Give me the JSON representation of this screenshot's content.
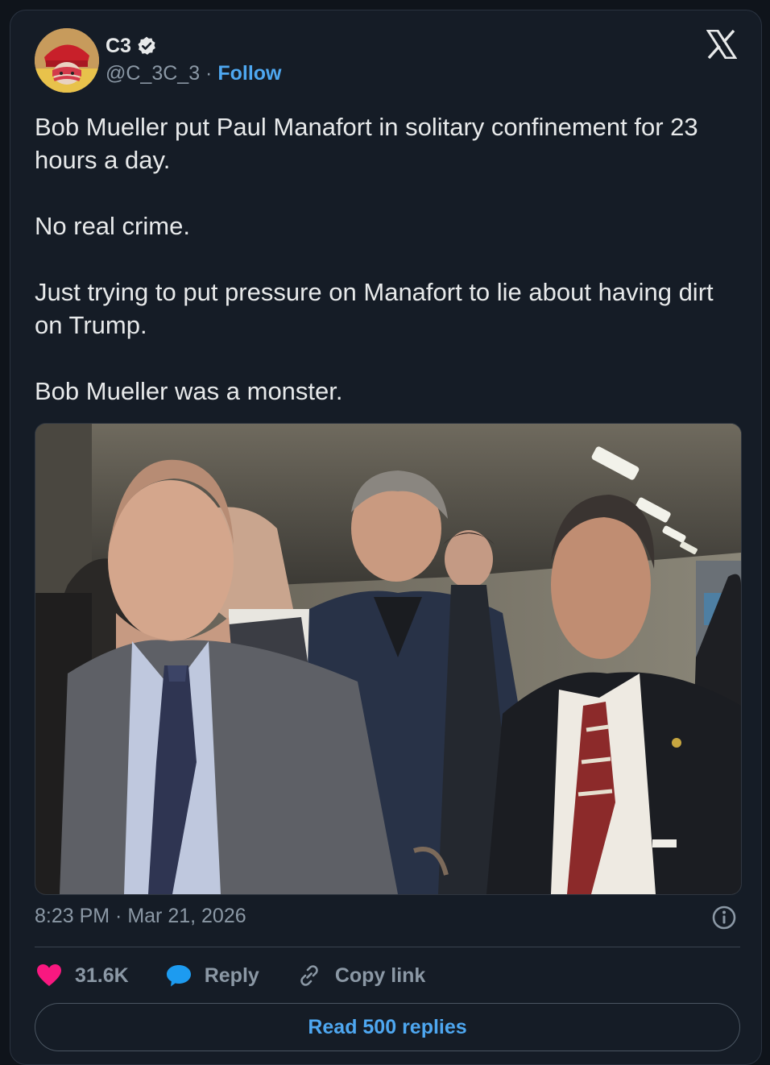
{
  "author": {
    "name": "C3",
    "handle": "@C_3C_3",
    "separator": " · ",
    "follow_label": "Follow",
    "verified": true,
    "avatar_icon": "avatar-image"
  },
  "brand_icon": "x-logo-icon",
  "tweet": {
    "paragraphs": [
      "Bob Mueller put Paul Manafort in solitary confinement for 23 hours a day.",
      "No real crime.",
      "Just trying to put pressure on Manafort to lie about having dirt on Trump.",
      "Bob Mueller was a monster."
    ]
  },
  "timestamp": "8:23 PM · Mar 21, 2026",
  "actions": {
    "likes": "31.6K",
    "reply_label": "Reply",
    "copy_link_label": "Copy link"
  },
  "read_replies_label": "Read 500 replies",
  "colors": {
    "background": "#151c26",
    "text": "#e7e9ea",
    "muted": "#8b98a5",
    "link": "#4ea7f0",
    "like": "#f91880",
    "reply": "#1d9bf0"
  }
}
